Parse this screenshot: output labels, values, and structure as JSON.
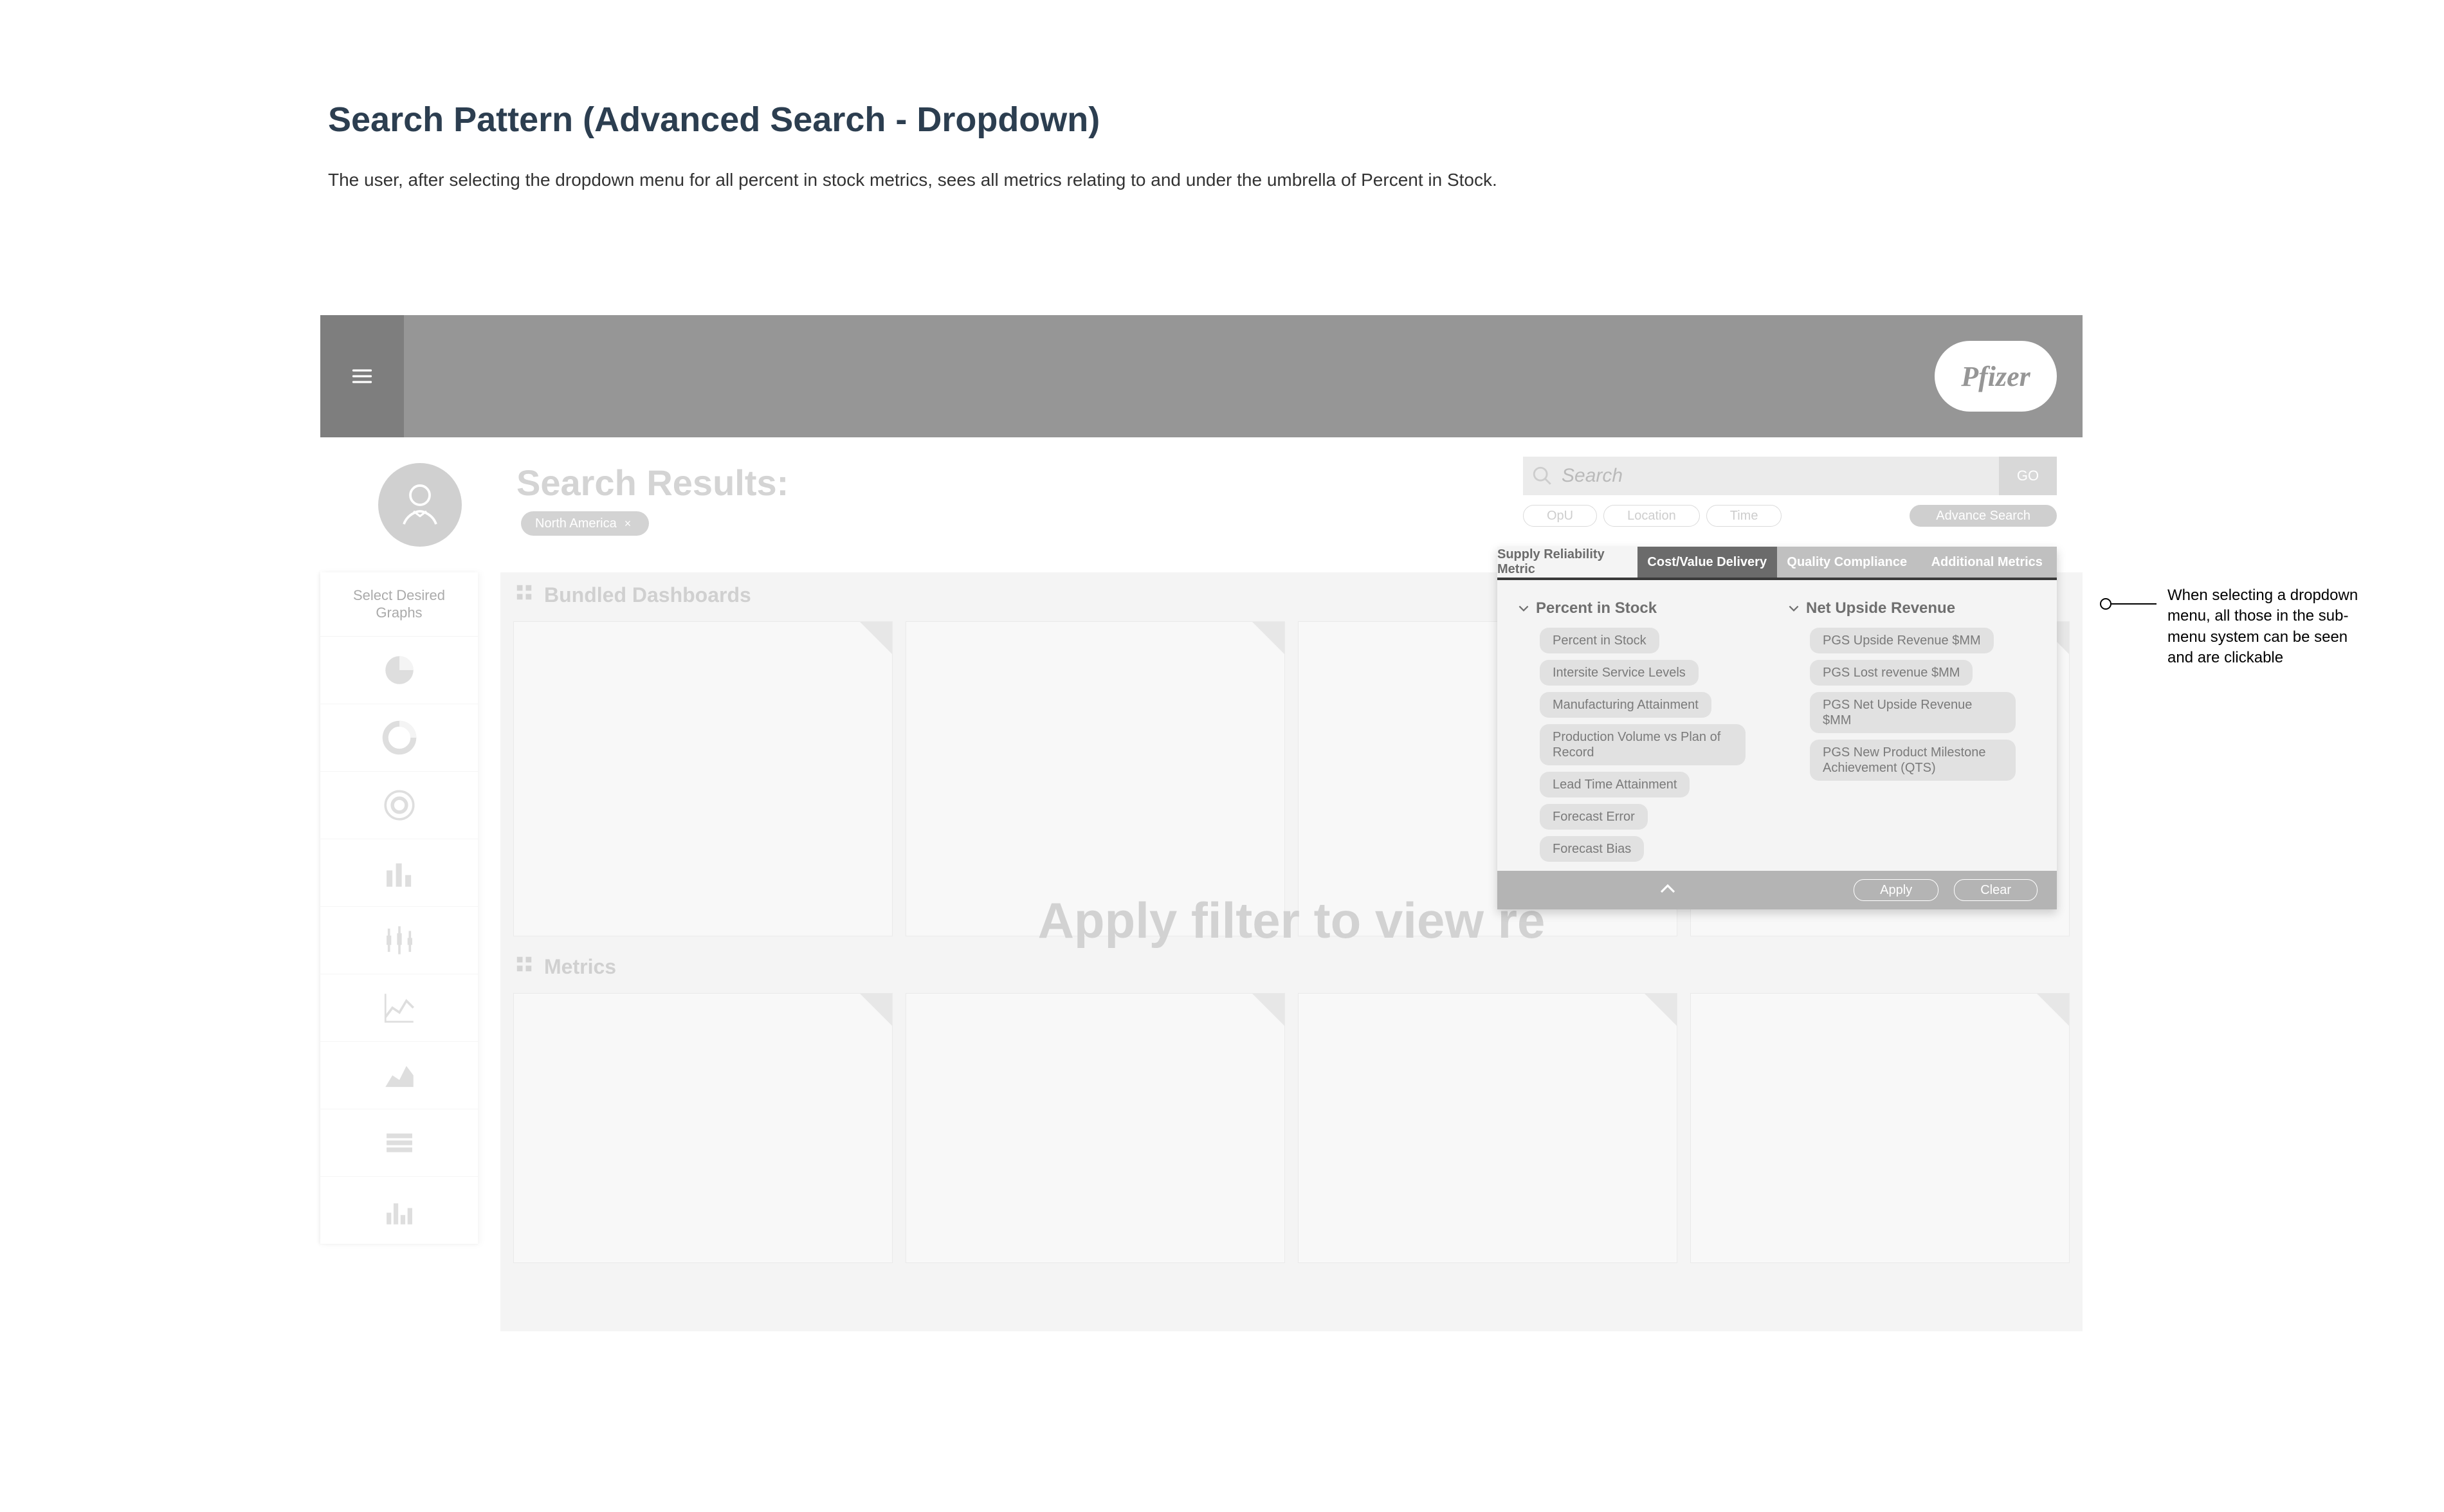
{
  "page": {
    "title": "Search Pattern (Advanced Search - Dropdown)",
    "description": "The user, after selecting the dropdown menu for all percent in stock metrics, sees all metrics relating to and under the umbrella of Percent in Stock."
  },
  "topbar": {
    "logo_text": "Pfizer"
  },
  "header": {
    "results_title": "Search Results:",
    "chips": [
      {
        "label": "North America"
      }
    ]
  },
  "search": {
    "placeholder": "Search",
    "go_label": "GO"
  },
  "filter_pills": {
    "opu": "OpU",
    "location": "Location",
    "time": "Time",
    "advance": "Advance Search"
  },
  "sidebar": {
    "title_line1": "Select Desired",
    "title_line2": "Graphs"
  },
  "main": {
    "bundled_label": "Bundled Dashboards",
    "metrics_label": "Metrics",
    "placeholder_text": "Apply filter to view re"
  },
  "adv_panel": {
    "tabs": {
      "supply": "Supply Reliability Metric",
      "cost": "Cost/Value Delivery",
      "quality": "Quality Compliance",
      "additional": "Additional Metrics"
    },
    "group1": {
      "title": "Percent in Stock",
      "items": [
        "Percent in Stock",
        "Intersite Service Levels",
        "Manufacturing Attainment",
        "Production Volume vs Plan of Record",
        "Lead Time Attainment",
        "Forecast Error",
        "Forecast Bias"
      ]
    },
    "group2": {
      "title": "Net Upside Revenue",
      "items": [
        "PGS Upside Revenue $MM",
        "PGS Lost revenue $MM",
        "PGS Net Upside Revenue $MM",
        "PGS New Product Milestone Achievement (QTS)"
      ]
    },
    "apply": "Apply",
    "clear": "Clear"
  },
  "annotation": {
    "text": "When selecting a dropdown menu, all those in the sub-menu system can be seen and are clickable"
  }
}
